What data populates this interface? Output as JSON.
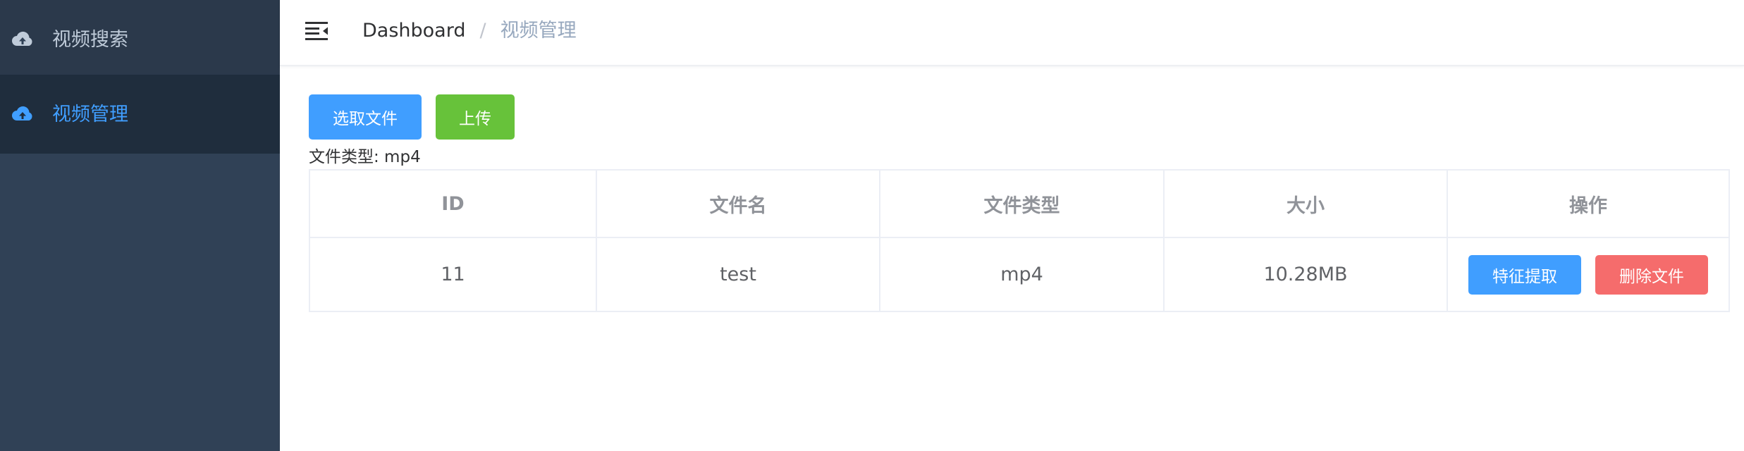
{
  "sidebar": {
    "items": [
      {
        "label": "视频搜索",
        "icon": "cloud-upload-icon",
        "active": false
      },
      {
        "label": "视频管理",
        "icon": "cloud-upload-icon",
        "active": true
      }
    ]
  },
  "header": {
    "breadcrumb": {
      "home": "Dashboard",
      "separator": "/",
      "current": "视频管理"
    }
  },
  "toolbar": {
    "select_label": "选取文件",
    "upload_label": "上传",
    "file_type_hint": "文件类型: mp4"
  },
  "table": {
    "headers": [
      "ID",
      "文件名",
      "文件类型",
      "大小",
      "操作"
    ],
    "rows": [
      {
        "id": "11",
        "name": "test",
        "type": "mp4",
        "size": "10.28MB",
        "actions": {
          "extract": "特征提取",
          "delete": "删除文件"
        }
      }
    ]
  },
  "colors": {
    "sidebar_bg": "#304156",
    "active_menu": "#409eff",
    "primary": "#409eff",
    "success": "#67c23a",
    "danger": "#f56c6c"
  }
}
